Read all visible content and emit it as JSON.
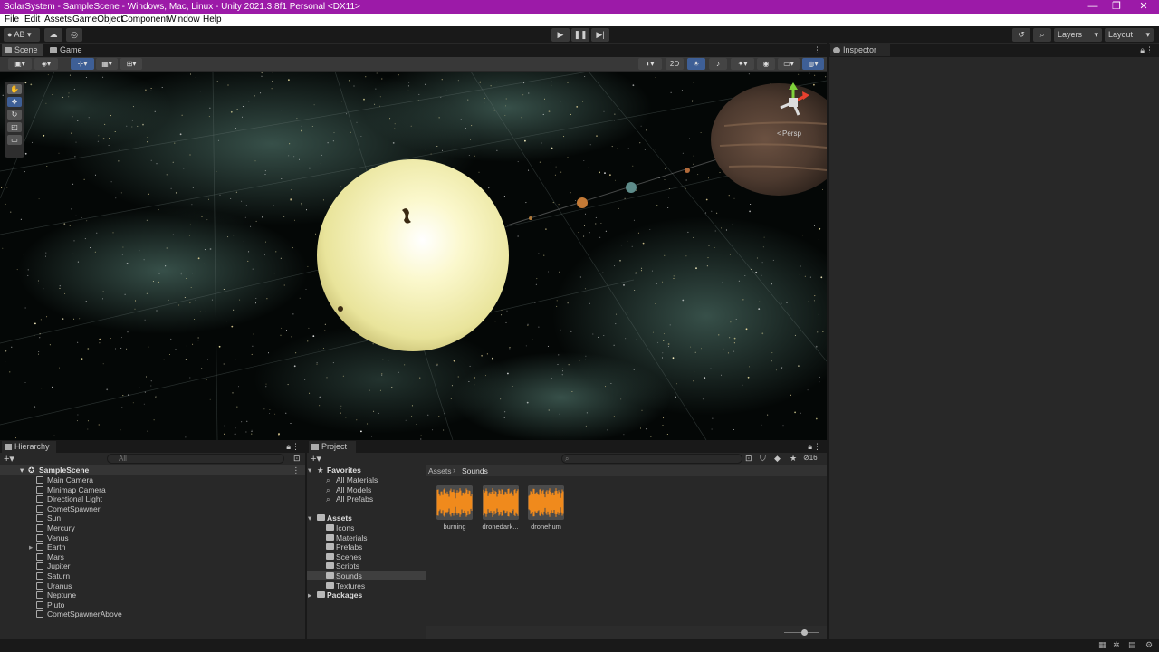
{
  "window": {
    "title": "SolarSystem - SampleScene - Windows, Mac, Linux - Unity 2021.3.8f1 Personal <DX11>",
    "controls": [
      "—",
      "❐",
      "✕"
    ]
  },
  "menu": [
    "File",
    "Edit",
    "Assets",
    "GameObject",
    "Component",
    "Window",
    "Help"
  ],
  "toolbar": {
    "account": "AB",
    "layers": "Layers",
    "layout": "Layout",
    "play_icon": "play-icon",
    "pause_icon": "pause-icon",
    "step_icon": "step-icon"
  },
  "scene_tabs": {
    "scene": "Scene",
    "game": "Game"
  },
  "scene_bar": {
    "mode_2d": "2D"
  },
  "scene_view": {
    "projection": "Persp"
  },
  "inspector": {
    "tab": "Inspector"
  },
  "hierarchy": {
    "tab": "Hierarchy",
    "search_placeholder": "All",
    "scene_name": "SampleScene",
    "objects": [
      "Main Camera",
      "Minimap Camera",
      "Directional Light",
      "CometSpawner",
      "Sun",
      "Mercury",
      "Venus",
      "Earth",
      "Mars",
      "Jupiter",
      "Saturn",
      "Uranus",
      "Neptune",
      "Pluto",
      "CometSpawnerAbove"
    ]
  },
  "project": {
    "tab": "Project",
    "favorites_label": "Favorites",
    "favorites": [
      "All Materials",
      "All Models",
      "All Prefabs"
    ],
    "assets_label": "Assets",
    "folders": [
      "Icons",
      "Materials",
      "Prefabs",
      "Scenes",
      "Scripts",
      "Sounds",
      "Textures"
    ],
    "packages_label": "Packages",
    "breadcrumb": [
      "Assets",
      "Sounds"
    ],
    "hidden_count": "16",
    "assets": [
      "burning",
      "dronedark...",
      "dronehum"
    ],
    "zoom_level": 0.6
  }
}
